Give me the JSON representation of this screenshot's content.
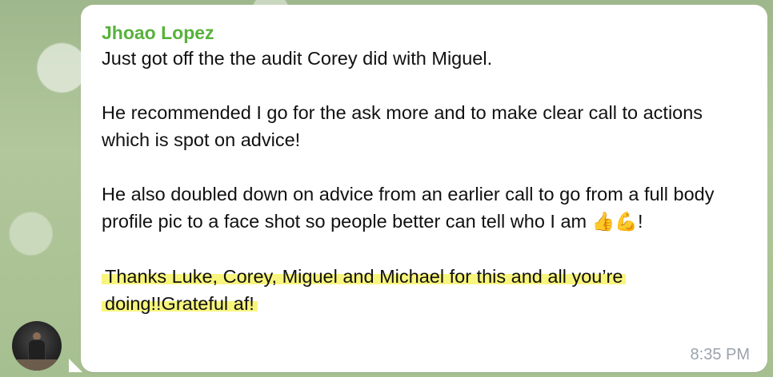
{
  "message": {
    "sender": "Jhoao Lopez",
    "paragraph1": "Just got off the the audit Corey did with Miguel.",
    "paragraph2": "He recommended I go for the ask more and to make clear call to actions which is spot on advice!",
    "paragraph3_text": "He also doubled down on advice from an earlier call to go from a full body profile pic to a face shot so people better can tell who I am ",
    "emoji_1": "👍",
    "emoji_2": "💪",
    "paragraph3_end": "!",
    "highlighted_text": "Thanks Luke, Corey, Miguel and Michael for this and all you’re doing!!Grateful af!",
    "time": "8:35 PM"
  },
  "colors": {
    "sender_name": "#57b23b",
    "highlight": "#f6f25a",
    "timestamp": "#9aa3ab",
    "bubble": "#ffffff"
  },
  "icons": {
    "avatar": "user-photo-avatar"
  }
}
